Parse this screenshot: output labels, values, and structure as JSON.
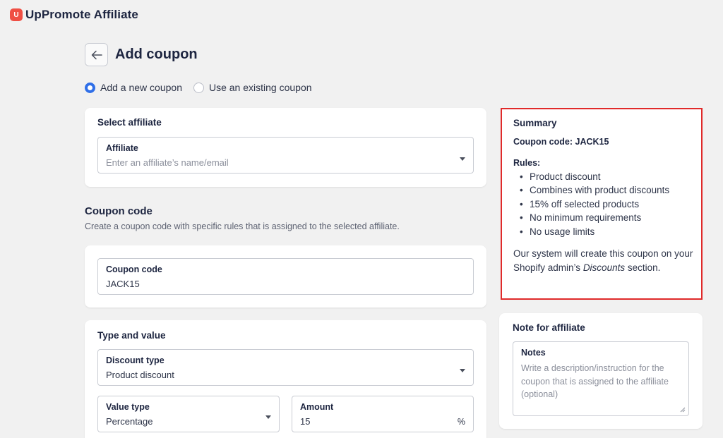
{
  "app": {
    "logo_letter": "U",
    "name": "UpPromote Affiliate"
  },
  "header": {
    "title": "Add coupon",
    "back_icon": "arrow-left-icon"
  },
  "coupon_mode": {
    "options": [
      {
        "label": "Add a new coupon",
        "selected": true
      },
      {
        "label": "Use an existing coupon",
        "selected": false
      }
    ]
  },
  "select_affiliate": {
    "title": "Select affiliate",
    "field_label": "Affiliate",
    "placeholder": "Enter an affiliate’s name/email"
  },
  "coupon_section": {
    "heading": "Coupon code",
    "description": "Create a coupon code with specific rules that is assigned to the selected affiliate.",
    "field_label": "Coupon code",
    "value": "JACK15"
  },
  "type_value": {
    "title": "Type and value",
    "discount_type_label": "Discount type",
    "discount_type_value": "Product discount",
    "value_type_label": "Value type",
    "value_type_value": "Percentage",
    "amount_label": "Amount",
    "amount_value": "15",
    "amount_suffix": "%"
  },
  "summary": {
    "title": "Summary",
    "coupon_code_line": "Coupon code: JACK15",
    "rules_label": "Rules:",
    "rules": [
      "Product discount",
      "Combines with product discounts",
      "15% off selected products",
      "No minimum requirements",
      "No usage limits"
    ],
    "note_before": "Our system will create this coupon on your Shopify admin’s ",
    "note_italic": "Discounts",
    "note_after": " section.",
    "highlight_color": "#e02a2a"
  },
  "note_for_affiliate": {
    "title": "Note for affiliate",
    "field_label": "Notes",
    "placeholder": "Write a description/instruction for the coupon that is assigned to the affiliate (optional)"
  },
  "colors": {
    "accent": "#2f6fe8",
    "brand": "#ef4f44",
    "background": "#f1f1f1"
  }
}
